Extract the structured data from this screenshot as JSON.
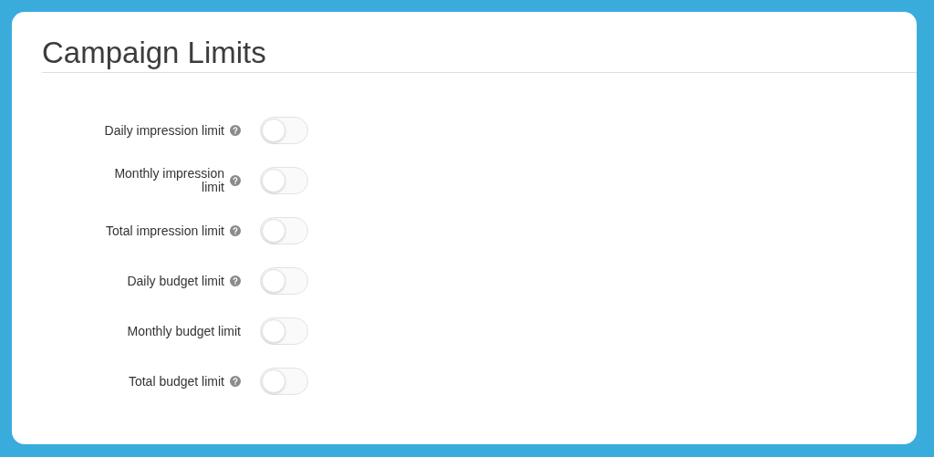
{
  "title": "Campaign Limits",
  "limits": [
    {
      "label": "Daily impression limit",
      "help": true,
      "on": false
    },
    {
      "label": "Monthly impression limit",
      "help": true,
      "on": false
    },
    {
      "label": "Total impression limit",
      "help": true,
      "on": false
    },
    {
      "label": "Daily budget limit",
      "help": true,
      "on": false
    },
    {
      "label": "Monthly budget limit",
      "help": false,
      "on": false
    },
    {
      "label": "Total budget limit",
      "help": true,
      "on": false
    }
  ]
}
